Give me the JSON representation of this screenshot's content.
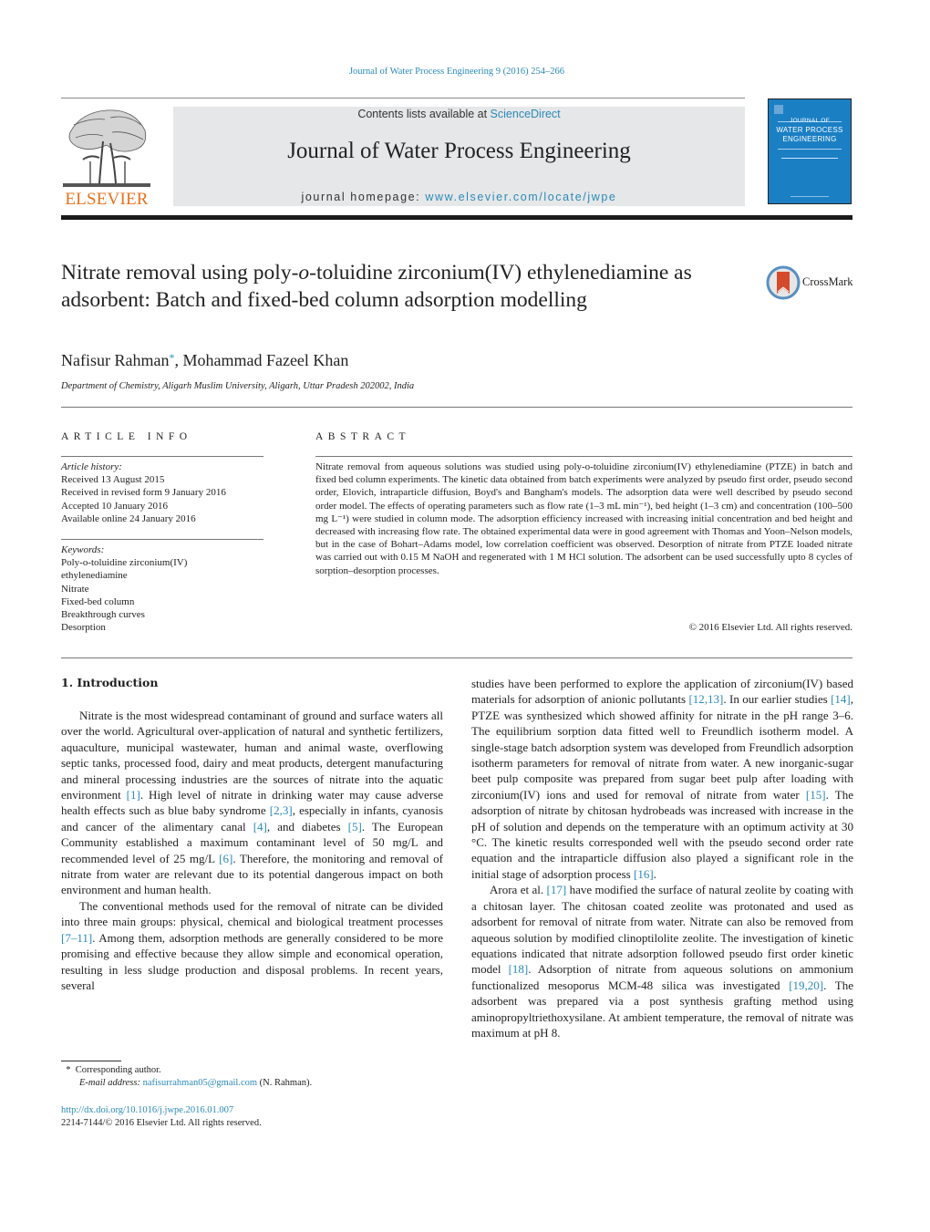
{
  "running_head": "Journal of Water Process Engineering 9 (2016) 254–266",
  "publisher": {
    "name": "ELSEVIER",
    "colors": {
      "elsevier_orange": "#e9711c",
      "link_blue": "#2a8ab8",
      "masthead_gray": "#e6e7e8",
      "cover_blue": "#1b7fc4"
    }
  },
  "masthead": {
    "contents_prefix": "Contents lists available at ",
    "contents_link": "ScienceDirect",
    "journal_title": "Journal of Water Process Engineering",
    "homepage_prefix": "journal homepage: ",
    "homepage_link": "www.elsevier.com/locate/jwpe"
  },
  "cover": {
    "line1": "JOURNAL OF",
    "line2": "WATER PROCESS",
    "line3": "ENGINEERING"
  },
  "article": {
    "title_part1": "Nitrate removal using poly-",
    "title_italic": "o",
    "title_part2": "-toluidine zirconium(IV) ethylenediamine as adsorbent: Batch and fixed-bed column adsorption modelling",
    "crossmark_label": "CrossMark",
    "authors": [
      {
        "name": "Nafisur Rahman",
        "mark": "*"
      },
      {
        "name": "Mohammad Fazeel Khan",
        "mark": ""
      }
    ],
    "author_separator": ", ",
    "affiliation": "Department of Chemistry, Aligarh Muslim University, Aligarh, Uttar Pradesh 202002, India"
  },
  "article_info": {
    "heading": "ARTICLE INFO",
    "history_label": "Article history:",
    "history": [
      "Received 13 August 2015",
      "Received in revised form 9 January 2016",
      "Accepted 10 January 2016",
      "Available online 24 January 2016"
    ],
    "keywords_label": "Keywords:",
    "keywords": [
      "Poly-o-toluidine zirconium(IV)",
      "ethylenediamine",
      "Nitrate",
      "Fixed-bed column",
      "Breakthrough curves",
      "Desorption"
    ]
  },
  "abstract": {
    "heading": "ABSTRACT",
    "text": "Nitrate removal from aqueous solutions was studied using poly-o-toluidine zirconium(IV) ethylenediamine (PTZE) in batch and fixed bed column experiments. The kinetic data obtained from batch experiments were analyzed by pseudo first order, pseudo second order, Elovich, intraparticle diffusion, Boyd's and Bangham's models. The adsorption data were well described by pseudo second order model. The effects of operating parameters such as flow rate (1–3 mL min⁻¹), bed height (1–3 cm) and concentration (100–500 mg L⁻¹) were studied in column mode. The adsorption efficiency increased with increasing initial concentration and bed height and decreased with increasing flow rate. The obtained experimental data were in good agreement with Thomas and Yoon–Nelson models, but in the case of Bohart–Adams model, low correlation coefficient was observed. Desorption of nitrate from PTZE loaded nitrate was carried out with 0.15 M NaOH and regenerated with 1 M HCl solution. The adsorbent can be used successfully upto 8 cycles of sorption–desorption processes.",
    "copyright": "© 2016 Elsevier Ltd. All rights reserved."
  },
  "introduction": {
    "heading": "1.  Introduction",
    "left_paragraphs": [
      [
        {
          "t": "Nitrate is the most widespread contaminant of ground and surface waters all over the world. Agricultural over-application of natural and synthetic fertilizers, aquaculture, municipal wastewater, human and animal waste, overflowing septic tanks, processed food, dairy and meat products, detergent manufacturing and mineral processing industries are the sources of nitrate into the aquatic environment "
        },
        {
          "ref": "[1]"
        },
        {
          "t": ". High level of nitrate in drinking water may cause adverse health effects such as blue baby syndrome "
        },
        {
          "ref": "[2,3]"
        },
        {
          "t": ", especially in infants, cyanosis and cancer of the alimentary canal "
        },
        {
          "ref": "[4]"
        },
        {
          "t": ", and diabetes "
        },
        {
          "ref": "[5]"
        },
        {
          "t": ". The European Community established a maximum contaminant level of 50 mg/L and recommended level of 25 mg/L "
        },
        {
          "ref": "[6]"
        },
        {
          "t": ". Therefore, the monitoring and removal of nitrate from water are relevant due to its potential dangerous impact on both environment and human health."
        }
      ],
      [
        {
          "t": "The conventional methods used for the removal of nitrate can be divided into three main groups: physical, chemical and biological treatment processes "
        },
        {
          "ref": "[7–11]"
        },
        {
          "t": ". Among them, adsorption methods are generally considered to be more promising and effective because they allow simple and economical operation, resulting in less sludge production and disposal problems. In recent years, several"
        }
      ]
    ],
    "right_paragraphs": [
      [
        {
          "t": "studies have been performed to explore the application of zirconium(IV) based materials for adsorption of anionic pollutants "
        },
        {
          "ref": "[12,13]"
        },
        {
          "t": ". In our earlier studies "
        },
        {
          "ref": "[14]"
        },
        {
          "t": ", PTZE was synthesized which showed affinity for nitrate in the pH range 3–6. The equilibrium sorption data fitted well to Freundlich isotherm model. A single-stage batch adsorption system was developed from Freundlich adsorption isotherm parameters for removal of nitrate from water. A new inorganic-sugar beet pulp composite was prepared from sugar beet pulp after loading with zirconium(IV) ions and used for removal of nitrate from water "
        },
        {
          "ref": "[15]"
        },
        {
          "t": ". The adsorption of nitrate by chitosan hydrobeads was increased with increase in the pH of solution and depends on the temperature with an optimum activity at 30 °C. The kinetic results corresponded well with the pseudo second order rate equation and the intraparticle diffusion also played a significant role in the initial stage of adsorption process "
        },
        {
          "ref": "[16]"
        },
        {
          "t": "."
        }
      ],
      [
        {
          "t": "Arora et al. "
        },
        {
          "ref": "[17]"
        },
        {
          "t": " have modified the surface of natural zeolite by coating with a chitosan layer. The chitosan coated zeolite was protonated and used as adsorbent for removal of nitrate from water. Nitrate can also be removed from aqueous solution by modified clinoptilolite zeolite. The investigation of kinetic equations indicated that nitrate adsorption followed pseudo first order kinetic model "
        },
        {
          "ref": "[18]"
        },
        {
          "t": ". Adsorption of nitrate from aqueous solutions on ammonium functionalized mesoporus MCM-48 silica was investigated "
        },
        {
          "ref": "[19,20]"
        },
        {
          "t": ". The adsorbent was prepared via a post synthesis grafting method using aminopropyltriethoxysilane. At ambient temperature, the removal of nitrate was maximum at pH 8."
        }
      ]
    ]
  },
  "footnote": {
    "mark": "*",
    "corresponding": "Corresponding author.",
    "email_label": "E-mail address: ",
    "email": "nafisurrahman05@gmail.com",
    "email_suffix": " (N. Rahman).",
    "doi": "http://dx.doi.org/10.1016/j.jwpe.2016.01.007",
    "issn_copyright": "2214-7144/© 2016 Elsevier Ltd. All rights reserved."
  }
}
